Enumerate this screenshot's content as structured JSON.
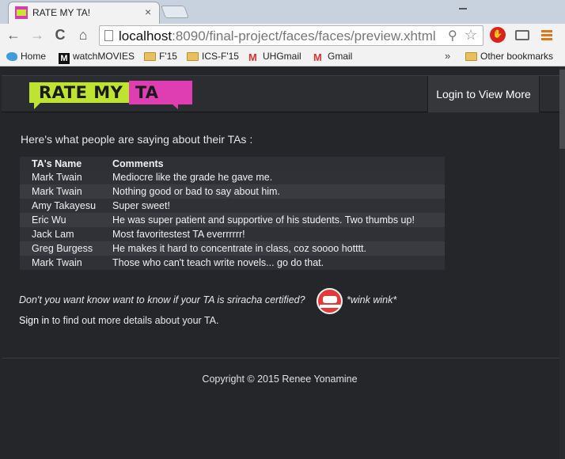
{
  "browser": {
    "tab_title": "RATE MY TA!",
    "tab_close": "×",
    "url_host": "localhost",
    "url_rest": ":8090/final-project/faces/faces/preview.xhtml",
    "nav_back": "←",
    "nav_forward": "→",
    "nav_reload": "C",
    "nav_home": "⌂",
    "bookmarks": [
      "Home",
      "watchMOVIES",
      "F'15",
      "ICS-F'15",
      "UHGmail",
      "Gmail"
    ],
    "bookmarks_overflow": "»",
    "other_bookmarks": "Other bookmarks"
  },
  "site": {
    "logo_part1": "RATE MY",
    "logo_part2": "TA",
    "login_label": "Login to View More",
    "accent_colors": {
      "lime": "#bfe331",
      "magenta": "#df3eb3"
    }
  },
  "main": {
    "heading": "Here's what people are saying about their TAs :",
    "table": {
      "headers": [
        "TA's Name",
        "Comments"
      ],
      "rows": [
        {
          "name": "Mark Twain",
          "comment": "Mediocre like the grade he gave me."
        },
        {
          "name": "Mark Twain",
          "comment": "Nothing good or bad to say about him."
        },
        {
          "name": "Amy Takayesu",
          "comment": "Super sweet!"
        },
        {
          "name": "Eric Wu",
          "comment": "He was super patient and supportive of his students. Two thumbs up!"
        },
        {
          "name": "Jack Lam",
          "comment": "Most favoritestest TA everrrrrr!"
        },
        {
          "name": "Greg Burgess",
          "comment": "He makes it hard to concentrate in class, coz soooo hotttt."
        },
        {
          "name": "Mark Twain",
          "comment": "Those who can't teach write novels... go do that."
        }
      ]
    },
    "tease": "Don't you want know want to know if your TA is sriracha certified?",
    "badge_icon": "sriracha-certified-badge",
    "wink": "*wink wink*",
    "signin_link": "Sign in",
    "signin_rest": " to find out more details about your TA."
  },
  "footer": {
    "copyright": "Copyright © 2015 Renee Yonamine"
  }
}
